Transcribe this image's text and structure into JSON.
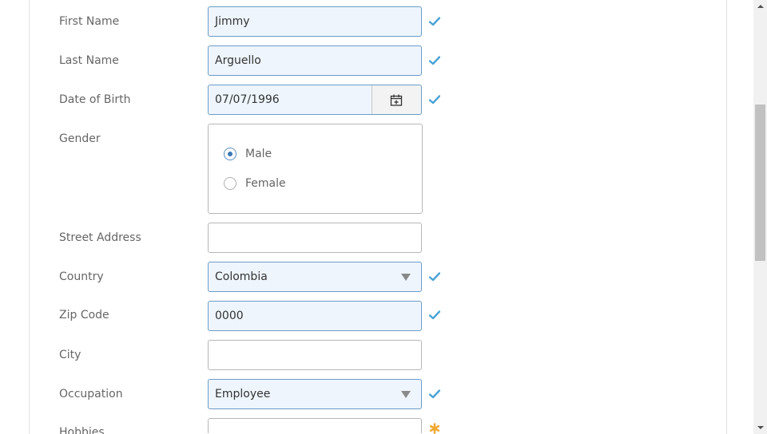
{
  "form": {
    "first_name": {
      "label": "First Name",
      "value": "Jimmy"
    },
    "last_name": {
      "label": "Last Name",
      "value": "Arguello"
    },
    "date_of_birth": {
      "label": "Date of Birth",
      "value": "07/07/1996"
    },
    "gender": {
      "label": "Gender",
      "options": [
        {
          "label": "Male",
          "selected": true
        },
        {
          "label": "Female",
          "selected": false
        }
      ]
    },
    "street_address": {
      "label": "Street Address",
      "value": ""
    },
    "country": {
      "label": "Country",
      "value": "Colombia"
    },
    "zip_code": {
      "label": "Zip Code",
      "value": "0000"
    },
    "city": {
      "label": "City",
      "value": ""
    },
    "occupation": {
      "label": "Occupation",
      "value": "Employee"
    },
    "hobbies": {
      "label": "Hobbies",
      "value": ""
    }
  },
  "colors": {
    "valid_check": "#4aa3d6",
    "required_asterisk": "#f0a830",
    "filled_background": "#eef5fc",
    "filled_border": "#6a9cc9"
  },
  "icons": {
    "valid": "check-icon",
    "required": "asterisk-icon",
    "calendar": "calendar-icon",
    "dropdown": "chevron-down-icon"
  },
  "scrollbar": {
    "position_fraction": 0.24
  }
}
